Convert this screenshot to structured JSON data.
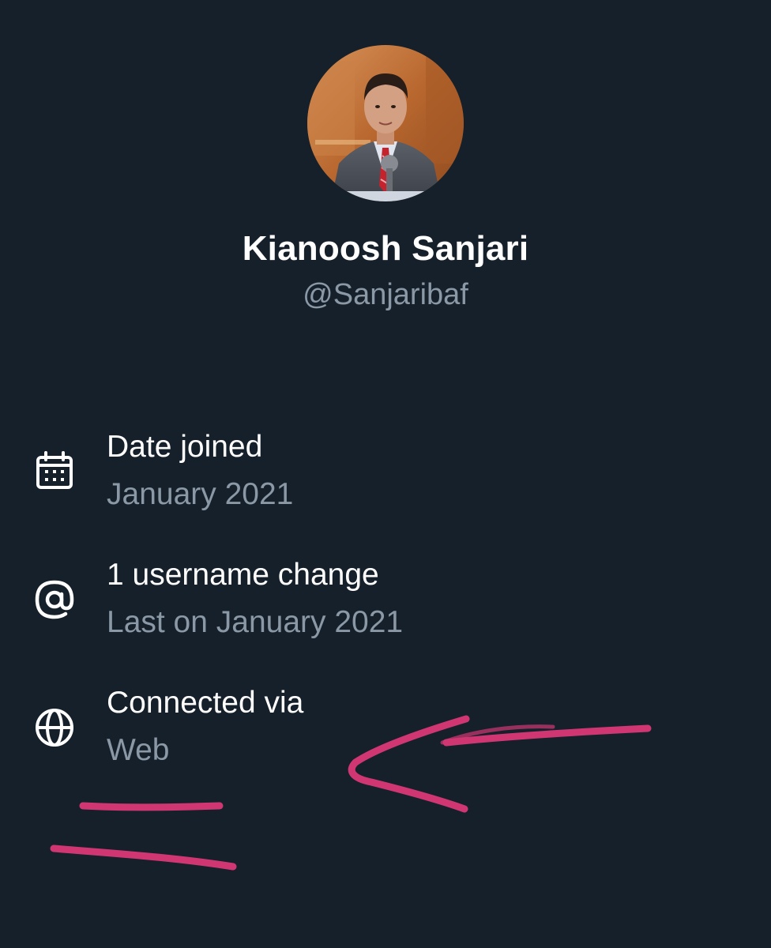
{
  "profile": {
    "display_name": "Kianoosh Sanjari",
    "handle": "@Sanjaribaf"
  },
  "about": {
    "date_joined": {
      "icon": "calendar-icon",
      "title": "Date joined",
      "value": "January 2021"
    },
    "username_changes": {
      "icon": "at-sign-icon",
      "title": "1 username change",
      "value": "Last on January 2021"
    },
    "connected_via": {
      "icon": "globe-icon",
      "title": "Connected via",
      "value": "Web"
    }
  },
  "colors": {
    "background": "#15202b",
    "primary_text": "#ffffff",
    "secondary_text": "#8b98a5",
    "annotation_ink": "#e23a7a"
  }
}
